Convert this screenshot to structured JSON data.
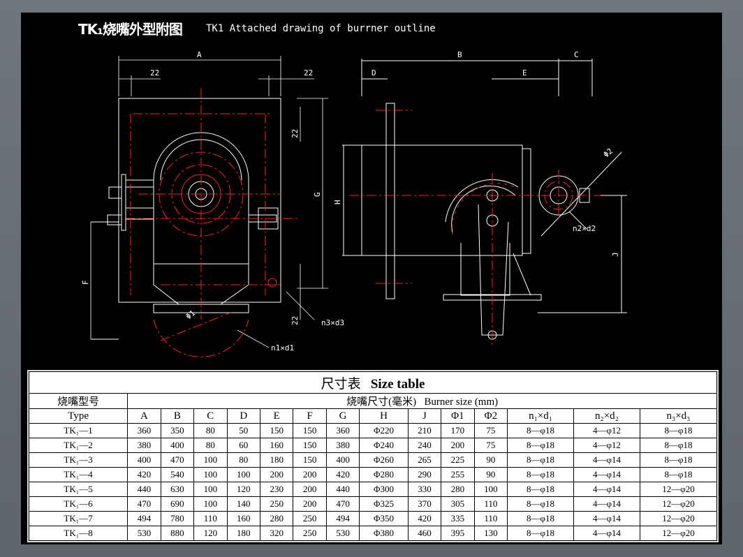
{
  "header": {
    "title_cn": "TK₁烧嘴外型附图",
    "title_en": "TK1 Attached drawing of burrner outline"
  },
  "drawing_labels": {
    "dim_a": "A",
    "dim_b": "B",
    "dim_c": "C",
    "dim_d": "D",
    "dim_e": "E",
    "dim_f": "F",
    "dim_g": "G",
    "dim_h": "H",
    "dim_j": "J",
    "dim_22_left": "22",
    "dim_22_right": "22",
    "dim_22_vert_top": "22",
    "dim_22_vert_bottom": "22",
    "phi1": "Φ1",
    "phi2": "Φ2",
    "n1d1": "n1×d1",
    "n2d2": "n2×d2",
    "n3d3": "n3×d3"
  },
  "table": {
    "caption_cn": "尺寸表",
    "caption_en": "Size table",
    "type_label_cn": "烧嘴型号",
    "type_label_en": "Type",
    "size_label_cn": "烧嘴尺寸(毫米)",
    "size_label_en": "Burner size (mm)",
    "columns": [
      "A",
      "B",
      "C",
      "D",
      "E",
      "F",
      "G",
      "H",
      "J",
      "Φ1",
      "Φ2",
      "n₁×d₁",
      "n₂×d₂",
      "n₃×d₃"
    ],
    "rows": [
      {
        "type": "TK₁—1",
        "cells": [
          "360",
          "350",
          "80",
          "50",
          "150",
          "150",
          "360",
          "Φ220",
          "210",
          "170",
          "75",
          "8—φ18",
          "4—φ12",
          "8—φ18"
        ]
      },
      {
        "type": "TK₁—2",
        "cells": [
          "380",
          "400",
          "80",
          "60",
          "160",
          "150",
          "380",
          "Φ240",
          "240",
          "200",
          "75",
          "8—φ18",
          "4—φ12",
          "8—φ18"
        ]
      },
      {
        "type": "TK₁—3",
        "cells": [
          "400",
          "470",
          "100",
          "80",
          "180",
          "150",
          "400",
          "Φ260",
          "265",
          "225",
          "90",
          "8—φ18",
          "4—φ14",
          "8—φ18"
        ]
      },
      {
        "type": "TK₁—4",
        "cells": [
          "420",
          "540",
          "100",
          "100",
          "200",
          "200",
          "420",
          "Φ280",
          "290",
          "255",
          "90",
          "8—φ18",
          "4—φ14",
          "8—φ18"
        ]
      },
      {
        "type": "TK₁—5",
        "cells": [
          "440",
          "630",
          "100",
          "120",
          "230",
          "200",
          "440",
          "Φ300",
          "330",
          "280",
          "100",
          "8—φ18",
          "4—φ14",
          "12—φ20"
        ]
      },
      {
        "type": "TK₁—6",
        "cells": [
          "470",
          "690",
          "100",
          "140",
          "250",
          "200",
          "470",
          "Φ325",
          "370",
          "305",
          "110",
          "8—φ18",
          "4—φ14",
          "12—φ20"
        ]
      },
      {
        "type": "TK₁—7",
        "cells": [
          "494",
          "780",
          "110",
          "160",
          "280",
          "250",
          "494",
          "Φ350",
          "420",
          "335",
          "110",
          "8—φ18",
          "4—φ14",
          "12—φ20"
        ]
      },
      {
        "type": "TK₁—8",
        "cells": [
          "530",
          "880",
          "120",
          "180",
          "320",
          "250",
          "530",
          "Φ380",
          "460",
          "395",
          "130",
          "8—φ18",
          "4—φ14",
          "12—φ20"
        ]
      }
    ]
  }
}
